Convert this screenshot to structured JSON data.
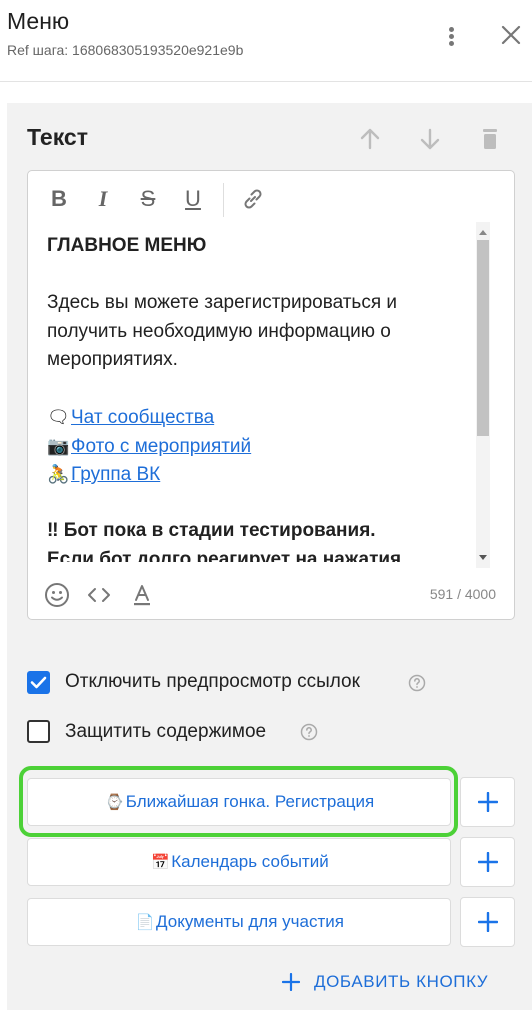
{
  "header": {
    "title": "Меню",
    "ref": "Ref шага: 168068305193520e921e9b"
  },
  "card": {
    "title": "Текст"
  },
  "toolbar": {
    "bold": "B",
    "italic": "I",
    "strike": "S",
    "underline": "U"
  },
  "content": {
    "heading": "ГЛАВНОЕ МЕНЮ",
    "intro": [
      "Здесь вы можете зарегистрироваться и",
      "получить необходимую информацию о",
      "мероприятиях."
    ],
    "links": [
      {
        "emoji": "🗨",
        "label": "Чат сообщества"
      },
      {
        "emoji": "📷",
        "label": "Фото с мероприятий"
      },
      {
        "emoji": "🚴",
        "label": "Группа ВК"
      }
    ],
    "warning": [
      "‼ Бот пока в стадии тестирования.",
      "Если бот долго реагирует на нажатия"
    ]
  },
  "editor_footer": {
    "counter": "591 / 4000"
  },
  "options": {
    "disable_preview": {
      "label": "Отключить предпросмотр ссылок",
      "checked": true
    },
    "protect_content": {
      "label": "Защитить содержимое",
      "checked": false
    }
  },
  "buttons": [
    {
      "emoji": "⌚",
      "label": "Ближайшая гонка. Регистрация"
    },
    {
      "emoji": "📅",
      "label": "Календарь событий"
    },
    {
      "emoji": "📄",
      "label": "Документы для участия"
    }
  ],
  "add_button": {
    "label": "ДОБАВИТЬ КНОПКУ"
  },
  "colors": {
    "accent": "#1a73e8",
    "link": "#1e6ed8",
    "highlight": "#4cd137",
    "panel": "#f2f2f2"
  }
}
